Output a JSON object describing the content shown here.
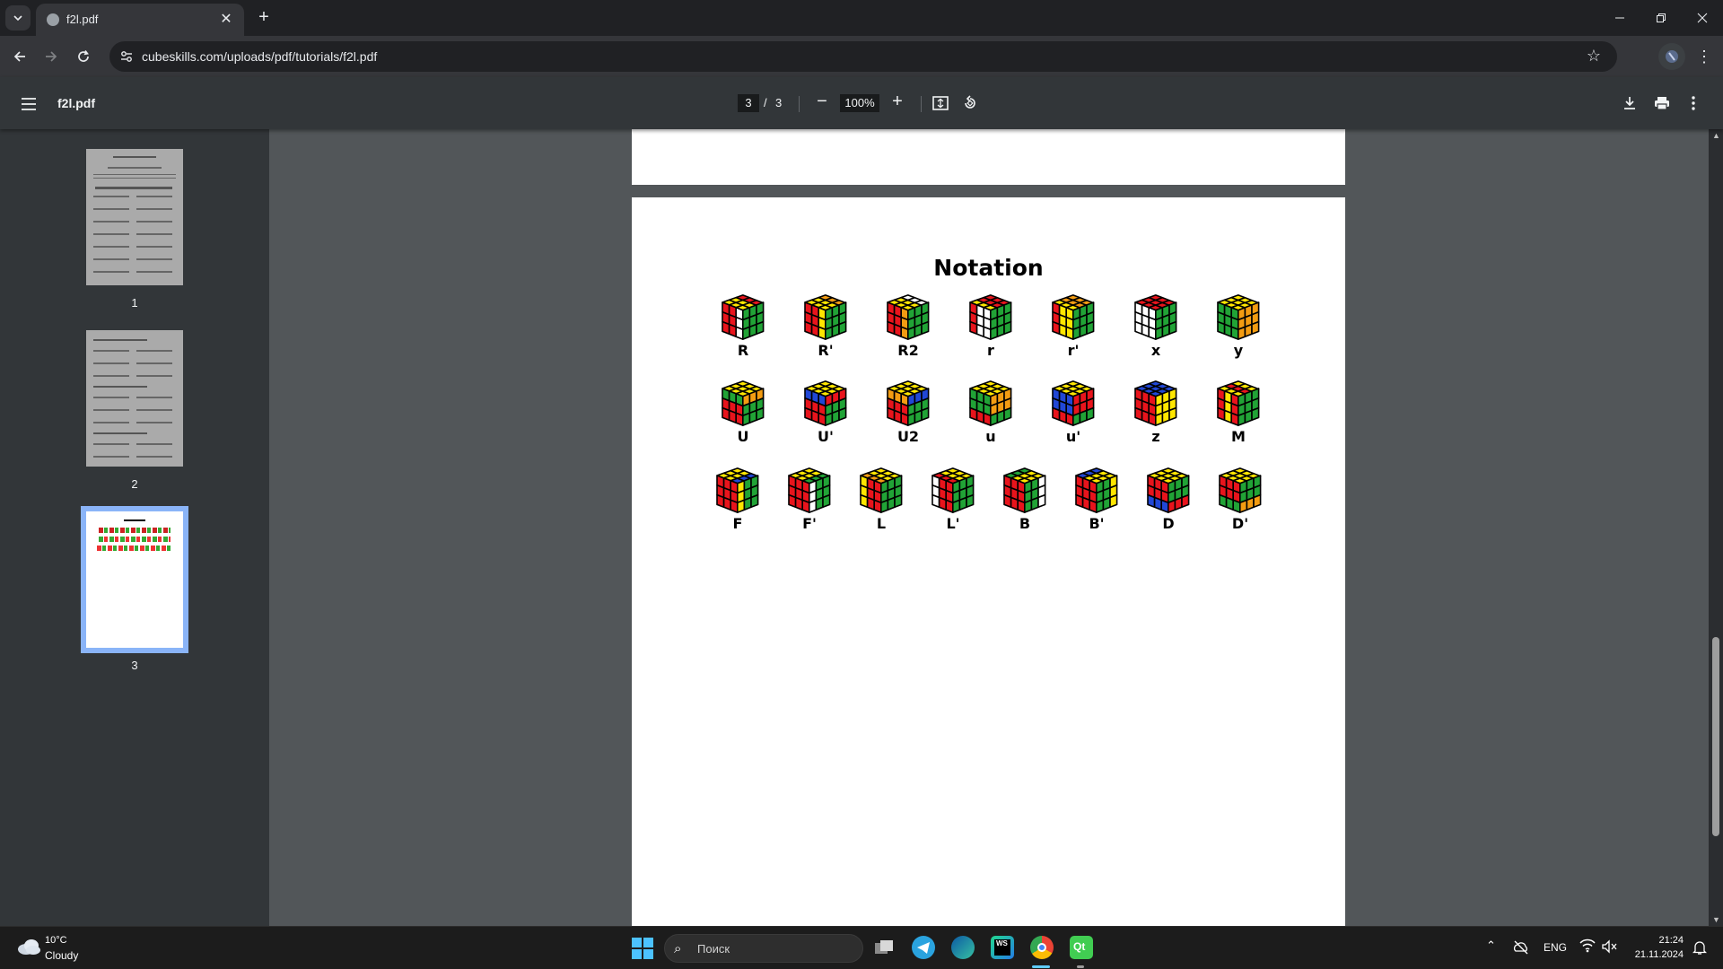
{
  "browser": {
    "tab_title": "f2l.pdf",
    "url": "cubeskills.com/uploads/pdf/tutorials/f2l.pdf"
  },
  "pdf": {
    "file_name": "f2l.pdf",
    "current_page": "3",
    "page_separator": "/",
    "total_pages": "3",
    "zoom": "100%"
  },
  "thumbnails": [
    {
      "label": "1",
      "selected": false
    },
    {
      "label": "2",
      "selected": false
    },
    {
      "label": "3",
      "selected": true
    }
  ],
  "page3": {
    "title": "Notation",
    "rows": [
      [
        "R",
        "R'",
        "R2",
        "r",
        "r'",
        "x",
        "y"
      ],
      [
        "U",
        "U'",
        "U2",
        "u",
        "u'",
        "z",
        "M"
      ],
      [
        "F",
        "F'",
        "L",
        "L'",
        "B",
        "B'",
        "D",
        "D'"
      ]
    ],
    "cube_colors": {
      "R": {
        "top": [
          "Y",
          "Y",
          "R",
          "Y",
          "Y",
          "R",
          "Y",
          "Y",
          "R"
        ],
        "front": [
          "R",
          "R",
          "W",
          "R",
          "R",
          "W",
          "R",
          "R",
          "W"
        ],
        "right": [
          "G",
          "G",
          "G",
          "G",
          "G",
          "G",
          "G",
          "G",
          "G"
        ]
      },
      "R'": {
        "top": [
          "Y",
          "Y",
          "O",
          "Y",
          "Y",
          "O",
          "Y",
          "Y",
          "O"
        ],
        "front": [
          "R",
          "R",
          "Y",
          "R",
          "R",
          "Y",
          "R",
          "R",
          "Y"
        ],
        "right": [
          "G",
          "G",
          "G",
          "G",
          "G",
          "G",
          "G",
          "G",
          "G"
        ]
      },
      "R2": {
        "top": [
          "Y",
          "Y",
          "W",
          "Y",
          "Y",
          "W",
          "Y",
          "Y",
          "W"
        ],
        "front": [
          "R",
          "R",
          "O",
          "R",
          "R",
          "O",
          "R",
          "R",
          "O"
        ],
        "right": [
          "G",
          "G",
          "G",
          "G",
          "G",
          "G",
          "G",
          "G",
          "G"
        ]
      },
      "r": {
        "top": [
          "Y",
          "R",
          "R",
          "Y",
          "R",
          "R",
          "Y",
          "R",
          "R"
        ],
        "front": [
          "R",
          "W",
          "W",
          "R",
          "W",
          "W",
          "R",
          "W",
          "W"
        ],
        "right": [
          "G",
          "G",
          "G",
          "G",
          "G",
          "G",
          "G",
          "G",
          "G"
        ]
      },
      "r'": {
        "top": [
          "Y",
          "O",
          "O",
          "Y",
          "O",
          "O",
          "Y",
          "O",
          "O"
        ],
        "front": [
          "R",
          "Y",
          "Y",
          "R",
          "Y",
          "Y",
          "R",
          "Y",
          "Y"
        ],
        "right": [
          "G",
          "G",
          "G",
          "G",
          "G",
          "G",
          "G",
          "G",
          "G"
        ]
      },
      "x": {
        "top": [
          "R",
          "R",
          "R",
          "R",
          "R",
          "R",
          "R",
          "R",
          "R"
        ],
        "front": [
          "W",
          "W",
          "W",
          "W",
          "W",
          "W",
          "W",
          "W",
          "W"
        ],
        "right": [
          "G",
          "G",
          "G",
          "G",
          "G",
          "G",
          "G",
          "G",
          "G"
        ]
      },
      "y": {
        "top": [
          "Y",
          "Y",
          "Y",
          "Y",
          "Y",
          "Y",
          "Y",
          "Y",
          "Y"
        ],
        "front": [
          "G",
          "G",
          "G",
          "G",
          "G",
          "G",
          "G",
          "G",
          "G"
        ],
        "right": [
          "O",
          "O",
          "O",
          "O",
          "O",
          "O",
          "O",
          "O",
          "O"
        ]
      },
      "U": {
        "top": [
          "Y",
          "Y",
          "Y",
          "Y",
          "Y",
          "Y",
          "Y",
          "Y",
          "Y"
        ],
        "front": [
          "G",
          "G",
          "G",
          "R",
          "R",
          "R",
          "R",
          "R",
          "R"
        ],
        "right": [
          "O",
          "O",
          "O",
          "G",
          "G",
          "G",
          "G",
          "G",
          "G"
        ]
      },
      "U'": {
        "top": [
          "Y",
          "Y",
          "Y",
          "Y",
          "Y",
          "Y",
          "Y",
          "Y",
          "Y"
        ],
        "front": [
          "B",
          "B",
          "B",
          "R",
          "R",
          "R",
          "R",
          "R",
          "R"
        ],
        "right": [
          "R",
          "R",
          "R",
          "G",
          "G",
          "G",
          "G",
          "G",
          "G"
        ]
      },
      "U2": {
        "top": [
          "Y",
          "Y",
          "Y",
          "Y",
          "Y",
          "Y",
          "Y",
          "Y",
          "Y"
        ],
        "front": [
          "O",
          "O",
          "O",
          "R",
          "R",
          "R",
          "R",
          "R",
          "R"
        ],
        "right": [
          "B",
          "B",
          "B",
          "G",
          "G",
          "G",
          "G",
          "G",
          "G"
        ]
      },
      "u": {
        "top": [
          "Y",
          "Y",
          "Y",
          "Y",
          "Y",
          "Y",
          "Y",
          "Y",
          "Y"
        ],
        "front": [
          "G",
          "G",
          "G",
          "G",
          "G",
          "G",
          "R",
          "R",
          "R"
        ],
        "right": [
          "O",
          "O",
          "O",
          "O",
          "O",
          "O",
          "G",
          "G",
          "G"
        ]
      },
      "u'": {
        "top": [
          "Y",
          "Y",
          "Y",
          "Y",
          "Y",
          "Y",
          "Y",
          "Y",
          "Y"
        ],
        "front": [
          "B",
          "B",
          "B",
          "B",
          "B",
          "B",
          "R",
          "R",
          "R"
        ],
        "right": [
          "R",
          "R",
          "R",
          "R",
          "R",
          "R",
          "G",
          "G",
          "G"
        ]
      },
      "z": {
        "top": [
          "B",
          "B",
          "B",
          "B",
          "B",
          "B",
          "B",
          "B",
          "B"
        ],
        "front": [
          "R",
          "R",
          "R",
          "R",
          "R",
          "R",
          "R",
          "R",
          "R"
        ],
        "right": [
          "Y",
          "Y",
          "Y",
          "Y",
          "Y",
          "Y",
          "Y",
          "Y",
          "Y"
        ]
      },
      "M": {
        "top": [
          "Y",
          "R",
          "Y",
          "Y",
          "R",
          "Y",
          "Y",
          "R",
          "Y"
        ],
        "front": [
          "R",
          "Y",
          "R",
          "R",
          "Y",
          "R",
          "R",
          "Y",
          "R"
        ],
        "right": [
          "G",
          "G",
          "G",
          "G",
          "G",
          "G",
          "G",
          "G",
          "G"
        ]
      },
      "F": {
        "top": [
          "Y",
          "Y",
          "Y",
          "Y",
          "Y",
          "Y",
          "B",
          "B",
          "B"
        ],
        "front": [
          "R",
          "R",
          "R",
          "R",
          "R",
          "R",
          "R",
          "R",
          "R"
        ],
        "right": [
          "Y",
          "G",
          "G",
          "Y",
          "G",
          "G",
          "Y",
          "G",
          "G"
        ]
      },
      "F'": {
        "top": [
          "Y",
          "Y",
          "Y",
          "Y",
          "Y",
          "Y",
          "G",
          "G",
          "G"
        ],
        "front": [
          "R",
          "R",
          "R",
          "R",
          "R",
          "R",
          "R",
          "R",
          "R"
        ],
        "right": [
          "W",
          "G",
          "G",
          "W",
          "G",
          "G",
          "W",
          "G",
          "G"
        ]
      },
      "L": {
        "top": [
          "O",
          "Y",
          "Y",
          "O",
          "Y",
          "Y",
          "O",
          "Y",
          "Y"
        ],
        "front": [
          "Y",
          "R",
          "R",
          "Y",
          "R",
          "R",
          "Y",
          "R",
          "R"
        ],
        "right": [
          "G",
          "G",
          "G",
          "G",
          "G",
          "G",
          "G",
          "G",
          "G"
        ]
      },
      "L'": {
        "top": [
          "R",
          "Y",
          "Y",
          "R",
          "Y",
          "Y",
          "R",
          "Y",
          "Y"
        ],
        "front": [
          "W",
          "R",
          "R",
          "W",
          "R",
          "R",
          "W",
          "R",
          "R"
        ],
        "right": [
          "G",
          "G",
          "G",
          "G",
          "G",
          "G",
          "G",
          "G",
          "G"
        ]
      },
      "B": {
        "top": [
          "G",
          "G",
          "G",
          "Y",
          "Y",
          "Y",
          "Y",
          "Y",
          "Y"
        ],
        "front": [
          "R",
          "R",
          "R",
          "R",
          "R",
          "R",
          "R",
          "R",
          "R"
        ],
        "right": [
          "G",
          "G",
          "W",
          "G",
          "G",
          "W",
          "G",
          "G",
          "W"
        ]
      },
      "B'": {
        "top": [
          "B",
          "B",
          "B",
          "Y",
          "Y",
          "Y",
          "Y",
          "Y",
          "Y"
        ],
        "front": [
          "R",
          "R",
          "R",
          "R",
          "R",
          "R",
          "R",
          "R",
          "R"
        ],
        "right": [
          "G",
          "G",
          "Y",
          "G",
          "G",
          "Y",
          "G",
          "G",
          "Y"
        ]
      },
      "D": {
        "top": [
          "Y",
          "Y",
          "Y",
          "Y",
          "Y",
          "Y",
          "Y",
          "Y",
          "Y"
        ],
        "front": [
          "R",
          "R",
          "R",
          "R",
          "R",
          "R",
          "B",
          "B",
          "B"
        ],
        "right": [
          "G",
          "G",
          "G",
          "G",
          "G",
          "G",
          "R",
          "R",
          "R"
        ]
      },
      "D'": {
        "top": [
          "Y",
          "Y",
          "Y",
          "Y",
          "Y",
          "Y",
          "Y",
          "Y",
          "Y"
        ],
        "front": [
          "R",
          "R",
          "R",
          "R",
          "R",
          "R",
          "G",
          "G",
          "G"
        ],
        "right": [
          "G",
          "G",
          "G",
          "G",
          "G",
          "G",
          "O",
          "O",
          "O"
        ]
      }
    },
    "palette": {
      "Y": "#ffe600",
      "R": "#e8141c",
      "G": "#21a336",
      "O": "#f39c12",
      "B": "#2147d6",
      "W": "#ffffff"
    }
  },
  "taskbar": {
    "weather_temp": "10°C",
    "weather_condition": "Cloudy",
    "search_placeholder": "Поиск",
    "language": "ENG",
    "time": "21:24",
    "date": "21.11.2024"
  },
  "colors": {
    "accent": "#8ab4f8",
    "viewer_bg": "#525659",
    "toolbar_bg": "#323639"
  }
}
